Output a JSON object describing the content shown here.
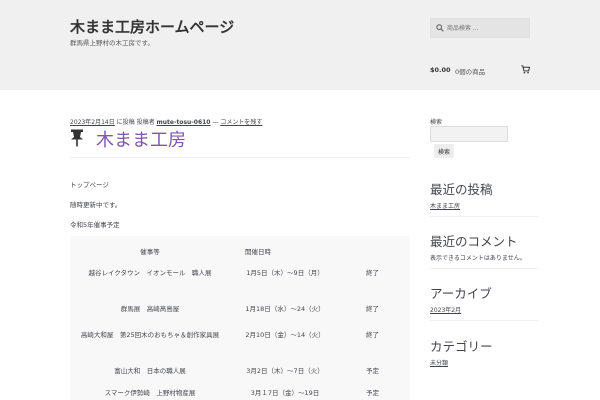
{
  "header": {
    "site_title": "木まま工房ホームページ",
    "site_description": "群馬県上野村の木工房です。",
    "search_placeholder": "商品検索 ...",
    "cart_amount": "$0.00",
    "cart_count": "0個の商品"
  },
  "post": {
    "meta": {
      "date": "2023年2月14日",
      "posted_label": "に投稿 投稿者",
      "author": "mute-tosu-0610",
      "separator": "—",
      "comment_link": "コメントを残す"
    },
    "title": "木まま工房",
    "paragraphs": [
      "トップページ",
      "随時更新中です。",
      "令和5年催事予定"
    ],
    "table": {
      "headers": [
        "催事等",
        "開催日時"
      ],
      "rows": [
        {
          "event": "越谷レイクタウン　イオンモール　職人展",
          "date": "1月5日（木）～9日（月）",
          "status": "終了"
        },
        {
          "event": "群馬展　高崎髙島屋",
          "date": "1月18日（水）～24（火）",
          "status": "終了"
        },
        {
          "event": "高崎大和屋　第25回木のおもちゃ＆創作家具展",
          "date": "2月10日（金）～14（火）",
          "status": "終了"
        },
        {
          "event": "富山大和　日本の職人展",
          "date": "3月2日（木）～7日（火）",
          "status": "予定"
        },
        {
          "event": "スマーク伊勢崎　上野村物産展",
          "date": "3月１7日（金）～19日",
          "status": "予定"
        }
      ]
    }
  },
  "sidebar": {
    "search_label": "検索",
    "search_button": "検索",
    "recent_posts_title": "最近の投稿",
    "recent_posts": [
      "木まま工房"
    ],
    "recent_comments_title": "最近のコメント",
    "recent_comments_text": "表示できるコメントはありません。",
    "archives_title": "アーカイブ",
    "archives": [
      "2023年2月"
    ],
    "categories_title": "カテゴリー",
    "categories": [
      "未分類"
    ]
  },
  "colors": {
    "accent": "#7f54b3",
    "header_bg": "#f0f0f0",
    "table_bg": "#f8f8f8"
  },
  "icons": [
    "search-icon",
    "cart-icon",
    "pin-icon"
  ]
}
